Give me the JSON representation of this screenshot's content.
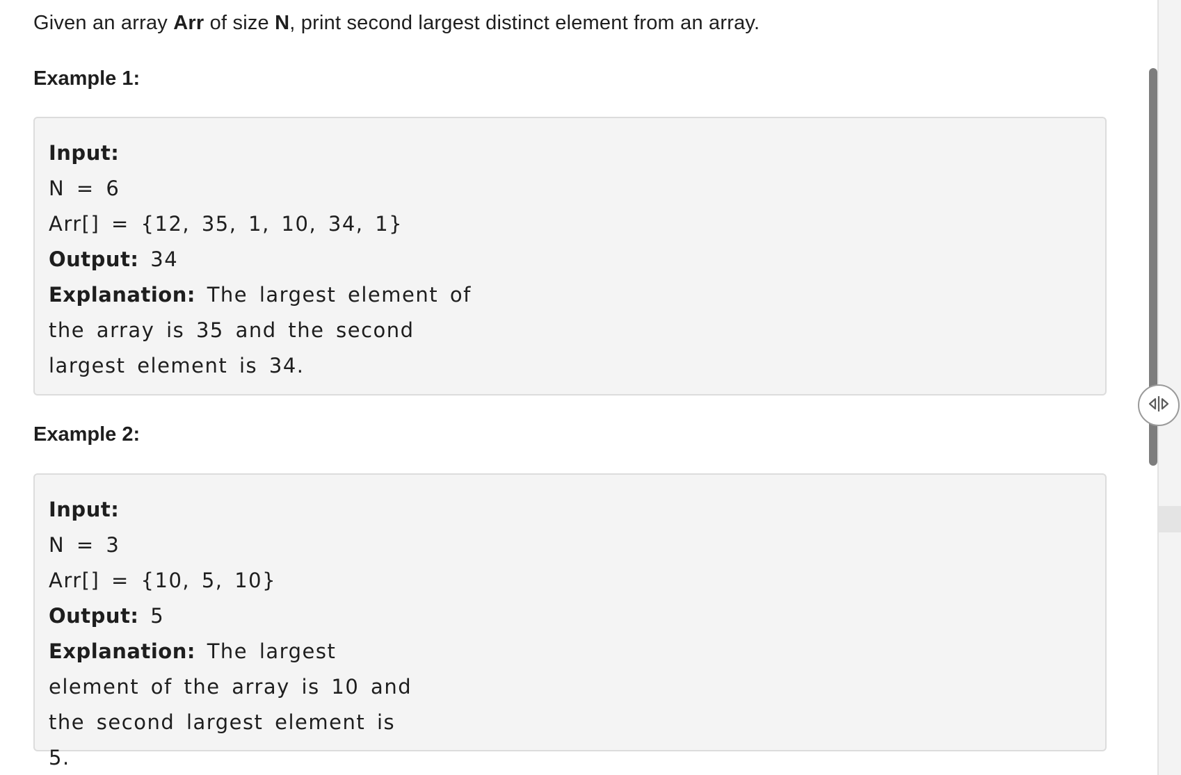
{
  "problem": {
    "intro_pre": "Given an array ",
    "intro_arr": "Arr",
    "intro_mid": " of size ",
    "intro_n": "N",
    "intro_post": ", print second largest distinct element from an array."
  },
  "examples": [
    {
      "heading": "Example 1:",
      "input_label": "Input:",
      "n_line": "N = 6",
      "arr_line": "Arr[] = {12, 35, 1, 10, 34, 1}",
      "output_label": "Output:",
      "output_value": "34",
      "explanation_label": "Explanation:",
      "explanation_text": "The largest element of the array is 35 and the second largest element is 34."
    },
    {
      "heading": "Example 2:",
      "input_label": "Input:",
      "n_line": "N = 3",
      "arr_line": "Arr[] = {10, 5, 10}",
      "output_label": "Output:",
      "output_value": "5",
      "explanation_label": "Explanation:",
      "explanation_text": "The largest element of the array is 10 and the second largest element is 5."
    }
  ],
  "ui": {
    "divider_icon": "resize-horizontal-icon",
    "scrollbar_color": "#7d7d7d",
    "box_background": "#f4f4f4"
  }
}
